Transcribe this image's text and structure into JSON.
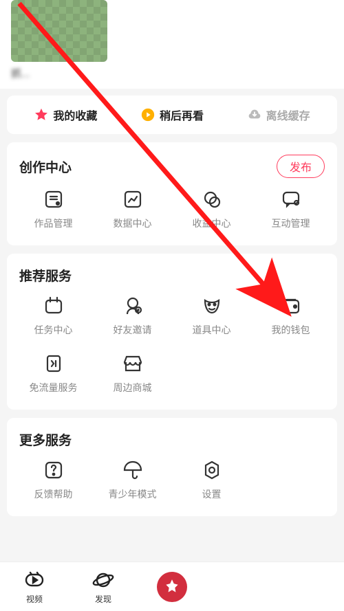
{
  "profile": {
    "caption": "抓..."
  },
  "quick": {
    "favorites": "我的收藏",
    "watch_later": "稍后再看",
    "offline": "离线缓存"
  },
  "creation": {
    "title": "创作中心",
    "publish": "发布",
    "items": [
      {
        "label": "作品管理"
      },
      {
        "label": "数据中心"
      },
      {
        "label": "收益中心"
      },
      {
        "label": "互动管理"
      }
    ]
  },
  "services": {
    "title": "推荐服务",
    "items": [
      {
        "label": "任务中心"
      },
      {
        "label": "好友邀请"
      },
      {
        "label": "道具中心"
      },
      {
        "label": "我的钱包"
      },
      {
        "label": "免流量服务"
      },
      {
        "label": "周边商城"
      }
    ]
  },
  "more": {
    "title": "更多服务",
    "items": [
      {
        "label": "反馈帮助"
      },
      {
        "label": "青少年模式"
      },
      {
        "label": "设置"
      }
    ]
  },
  "nav": {
    "video": "视频",
    "discover": "发现"
  }
}
